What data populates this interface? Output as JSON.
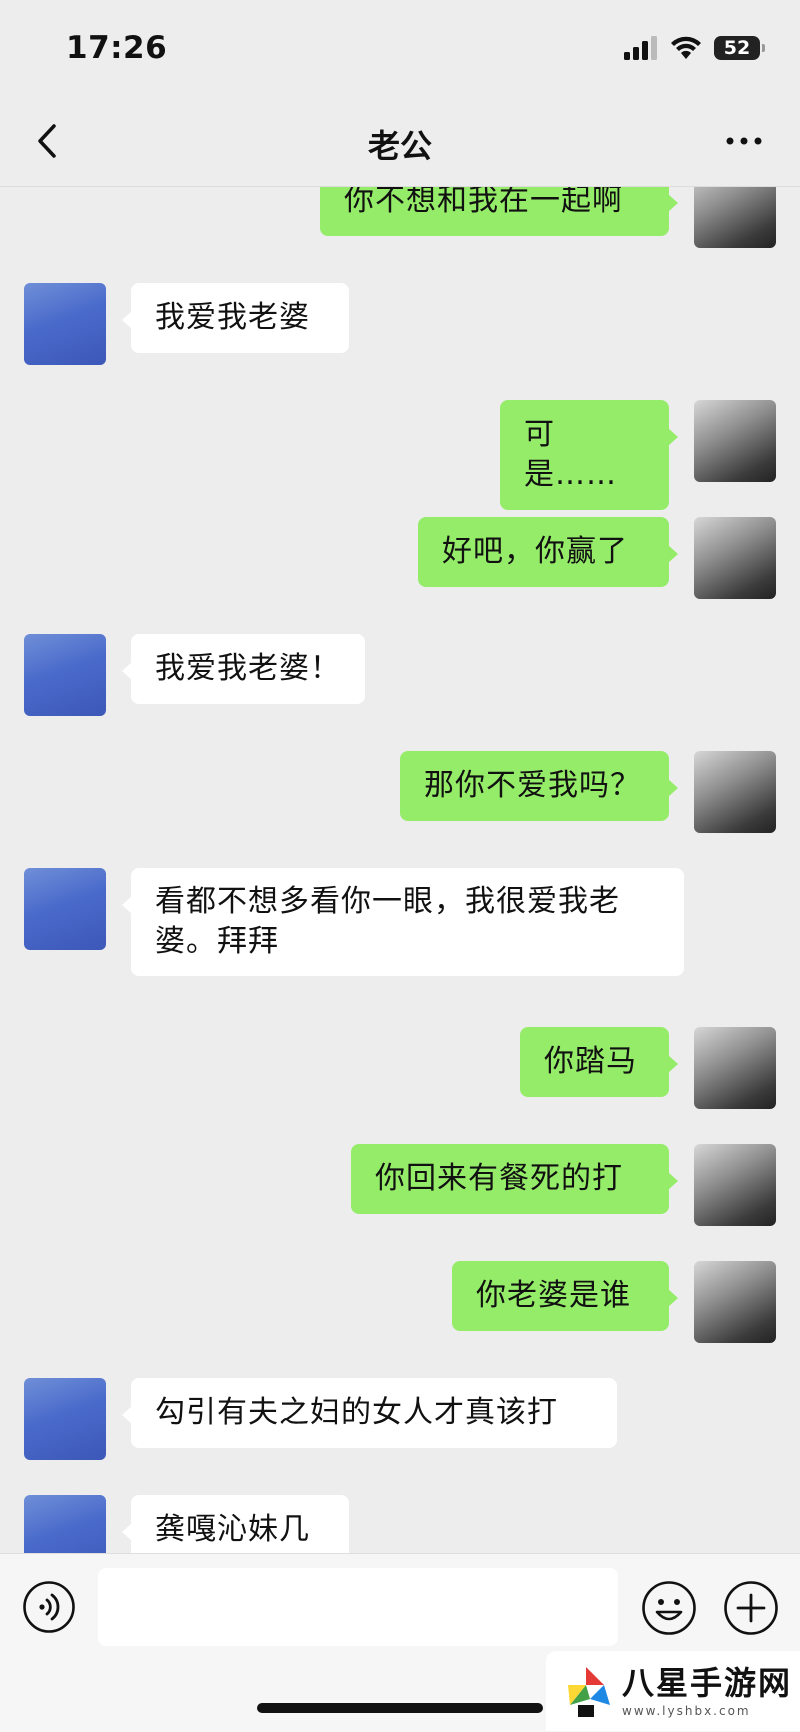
{
  "status": {
    "time": "17:26",
    "battery": "52"
  },
  "nav": {
    "title": "老公"
  },
  "messages": [
    {
      "side": "out",
      "text": "你不想和我在一起啊"
    },
    {
      "side": "in",
      "text": "我爱我老婆"
    },
    {
      "side": "out",
      "text": "可是……"
    },
    {
      "side": "out",
      "text": "好吧，你赢了"
    },
    {
      "side": "in",
      "text": "我爱我老婆！"
    },
    {
      "side": "out",
      "text": "那你不爱我吗？"
    },
    {
      "side": "in",
      "text": "看都不想多看你一眼，我很爱我老婆。拜拜"
    },
    {
      "side": "out",
      "text": "你踏马"
    },
    {
      "side": "out",
      "text": "你回来有餐死的打"
    },
    {
      "side": "out",
      "text": "你老婆是谁"
    },
    {
      "side": "in",
      "text": "勾引有夫之妇的女人才真该打"
    },
    {
      "side": "in",
      "text": "龚嘎沁妹几"
    }
  ],
  "input": {
    "value": ""
  },
  "watermark": {
    "title": "八星手游网",
    "url": "www.lyshbx.com"
  },
  "icons": {
    "back": "chevron-left-icon",
    "more": "more-dots-icon",
    "voice": "voice-icon",
    "emoji": "emoji-icon",
    "plus": "plus-icon"
  },
  "colors": {
    "outgoing_bubble": "#95ec69",
    "incoming_bubble": "#ffffff",
    "background": "#ededed"
  }
}
